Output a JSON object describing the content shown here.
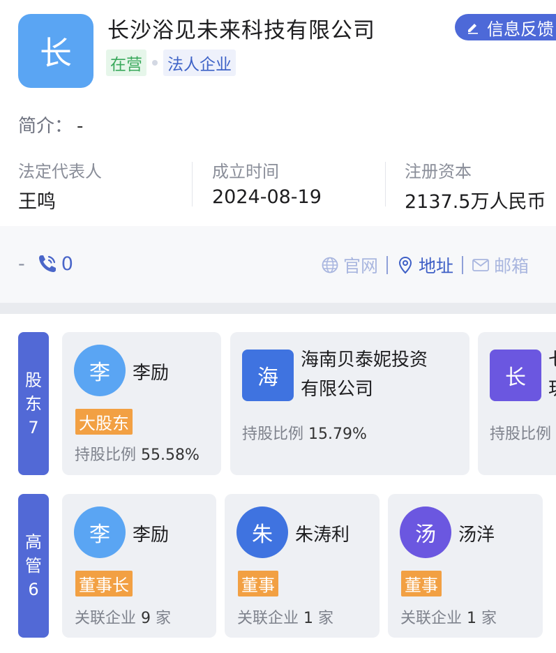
{
  "company": {
    "logo_char": "长",
    "name": "长沙浴见未来科技有限公司",
    "status_tag": "在营",
    "type_tag": "法人企业",
    "feedback_label": "信息反馈"
  },
  "intro": {
    "label": "简介：",
    "value": "-"
  },
  "stats": [
    {
      "label": "法定代表人",
      "value": "王鸣"
    },
    {
      "label": "成立时间",
      "value": "2024-08-19"
    },
    {
      "label": "注册资本",
      "value": "2137.5万人民币"
    }
  ],
  "contact": {
    "prefix": "-",
    "phone_count": "0",
    "website": "官网",
    "address": "地址",
    "email": "邮箱"
  },
  "shareholders": {
    "label_top": "股",
    "label_bottom": "东",
    "count": "7",
    "items": [
      {
        "avatar": "李",
        "name": "李励",
        "role": "大股东",
        "ratio_label": "持股比例",
        "ratio": "55.58%"
      },
      {
        "avatar": "海",
        "name_line1": "海南贝泰妮投资",
        "name_line2": "有限公司",
        "ratio_label": "持股比例",
        "ratio": "15.79%"
      },
      {
        "avatar": "长",
        "name_partial1": "七",
        "name_partial2": "玥",
        "ratio_label": "持股比例"
      }
    ]
  },
  "executives": {
    "label_top": "高",
    "label_bottom": "管",
    "count": "6",
    "items": [
      {
        "avatar": "李",
        "name": "李励",
        "role": "董事长",
        "meta_label": "关联企业",
        "meta_num": "9",
        "meta_unit": "家"
      },
      {
        "avatar": "朱",
        "name": "朱涛利",
        "role": "董事",
        "meta_label": "关联企业",
        "meta_num": "1",
        "meta_unit": "家"
      },
      {
        "avatar": "汤",
        "name": "汤洋",
        "role": "董事",
        "meta_label": "关联企业",
        "meta_num": "1",
        "meta_unit": "家"
      }
    ]
  },
  "colors": {
    "accent": "#4d69d8",
    "label_blue": "#5269d6",
    "avatar_light_blue": "#5aa5f3",
    "avatar_blue": "#3f73e0",
    "avatar_purple": "#6b57e0",
    "role_orange": "#f2a043",
    "status_green": "#3aa95c"
  }
}
